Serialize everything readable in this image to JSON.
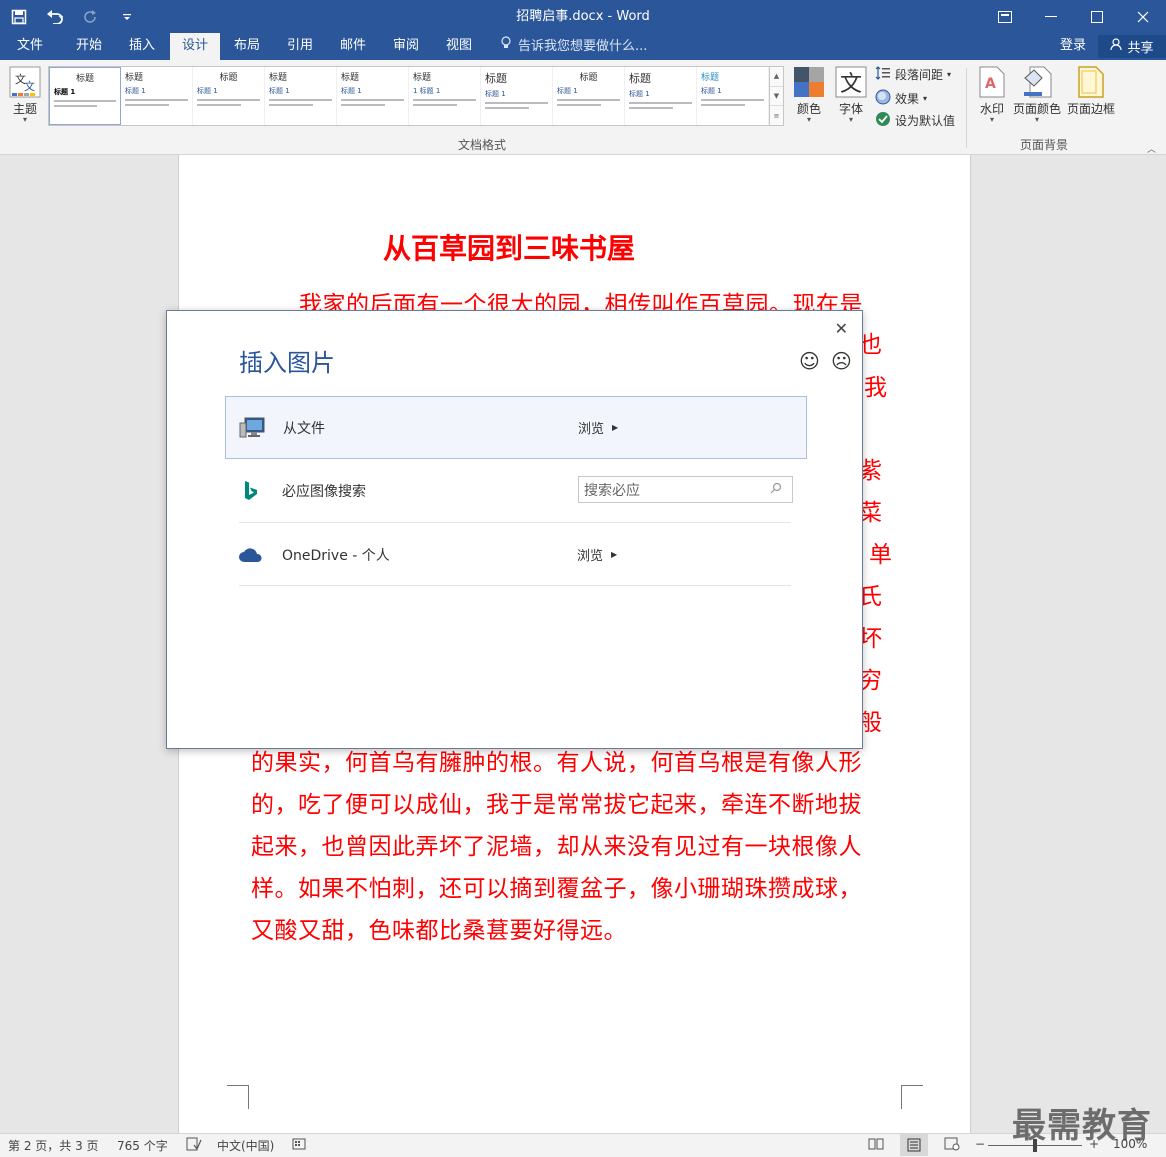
{
  "app": {
    "doc_title": "招聘启事.docx - Word"
  },
  "tabs": [
    {
      "label": "文件"
    },
    {
      "label": "开始"
    },
    {
      "label": "插入"
    },
    {
      "label": "设计"
    },
    {
      "label": "布局"
    },
    {
      "label": "引用"
    },
    {
      "label": "邮件"
    },
    {
      "label": "审阅"
    },
    {
      "label": "视图"
    }
  ],
  "tellme": {
    "label": "告诉我您想要做什么..."
  },
  "account": {
    "signin": "登录",
    "share": "共享"
  },
  "ribbon": {
    "theme": "主题",
    "gallery": [
      {
        "title": "标题",
        "heading": "标题 1"
      },
      {
        "title": "标题",
        "heading": "标题 1"
      },
      {
        "title": "标题",
        "heading": "标题 1"
      },
      {
        "title": "标题",
        "heading": "标题 1"
      },
      {
        "title": "标题",
        "heading": "标题 1"
      },
      {
        "title": "标题",
        "heading": "1 标题 1"
      },
      {
        "title": "标题",
        "heading": "标题 1"
      },
      {
        "title": "标题",
        "heading": "标题 1"
      },
      {
        "title": "标题",
        "heading": "标题 1"
      },
      {
        "title": "标题",
        "heading": "标题 1"
      }
    ],
    "doc_format_group": "文档格式",
    "colors": "颜色",
    "fonts": "字体",
    "paragraph_spacing": "段落间距",
    "effects": "效果",
    "set_default": "设为默认值",
    "watermark": "水印",
    "page_color": "页面颜色",
    "page_borders": "页面边框",
    "page_background_group": "页面背景"
  },
  "document": {
    "title": "从百草园到三味书屋",
    "lines": [
      "我家的后面有一个很大的园，相传叫作百草园。现在是",
      "的果实，何首乌有臃肿的根。有人说，何首乌根是有像人形",
      "的，吃了便可以成仙，我于是常常拔它起来，牵连不断地拔",
      "起来，也曾因此弄坏了泥墙，却从来没有见过有一块根像人",
      "样。如果不怕刺，还可以摘到覆盆子，像小珊瑚珠攒成球，",
      "又酸又甜，色味都比桑葚要好得远。"
    ],
    "right_fragments": [
      "也",
      "我",
      "紫",
      "菜",
      "单",
      "氏",
      "坏",
      "穷",
      "般"
    ]
  },
  "dialog": {
    "title": "插入图片",
    "rows": [
      {
        "label": "从文件",
        "action": "浏览"
      },
      {
        "label": "必应图像搜索",
        "search_placeholder": "搜索必应"
      },
      {
        "label": "OneDrive - 个人",
        "action": "浏览"
      }
    ]
  },
  "status": {
    "page": "第 2 页，共 3 页",
    "words": "765 个字",
    "language": "中文(中国)",
    "zoom": "100%"
  },
  "watermark": "最需教育"
}
